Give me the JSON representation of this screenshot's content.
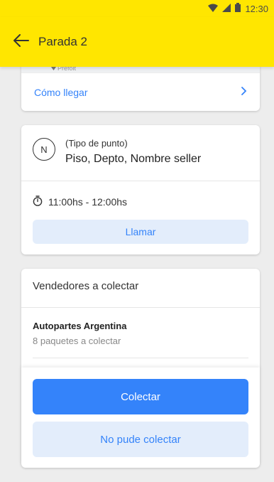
{
  "status_bar": {
    "time": "12:30",
    "icons": [
      "wifi-icon",
      "signal-icon",
      "battery-icon"
    ]
  },
  "app_bar": {
    "title": "Parada 2",
    "back_icon": "arrow-left-icon"
  },
  "map": {
    "pin_label": "Prefolt"
  },
  "directions": {
    "label": "Cómo llegar",
    "chevron_icon": "chevron-right-icon"
  },
  "stop": {
    "badge": "N",
    "type": "(Tipo de punto)",
    "address": "Piso, Depto, Nombre seller",
    "time_window": "11:00hs - 12:00hs",
    "call_label": "Llamar"
  },
  "sellers": {
    "title": "Vendedores a colectar",
    "items": [
      {
        "name": "Autopartes Argentina",
        "packages": "8 paquetes a colectar"
      }
    ]
  },
  "actions": {
    "collect_label": "Colectar",
    "failed_label": "No pude colectar"
  },
  "colors": {
    "brand_yellow": "#ffe600",
    "primary_blue": "#3483fa",
    "light_blue": "#e3edfb"
  }
}
